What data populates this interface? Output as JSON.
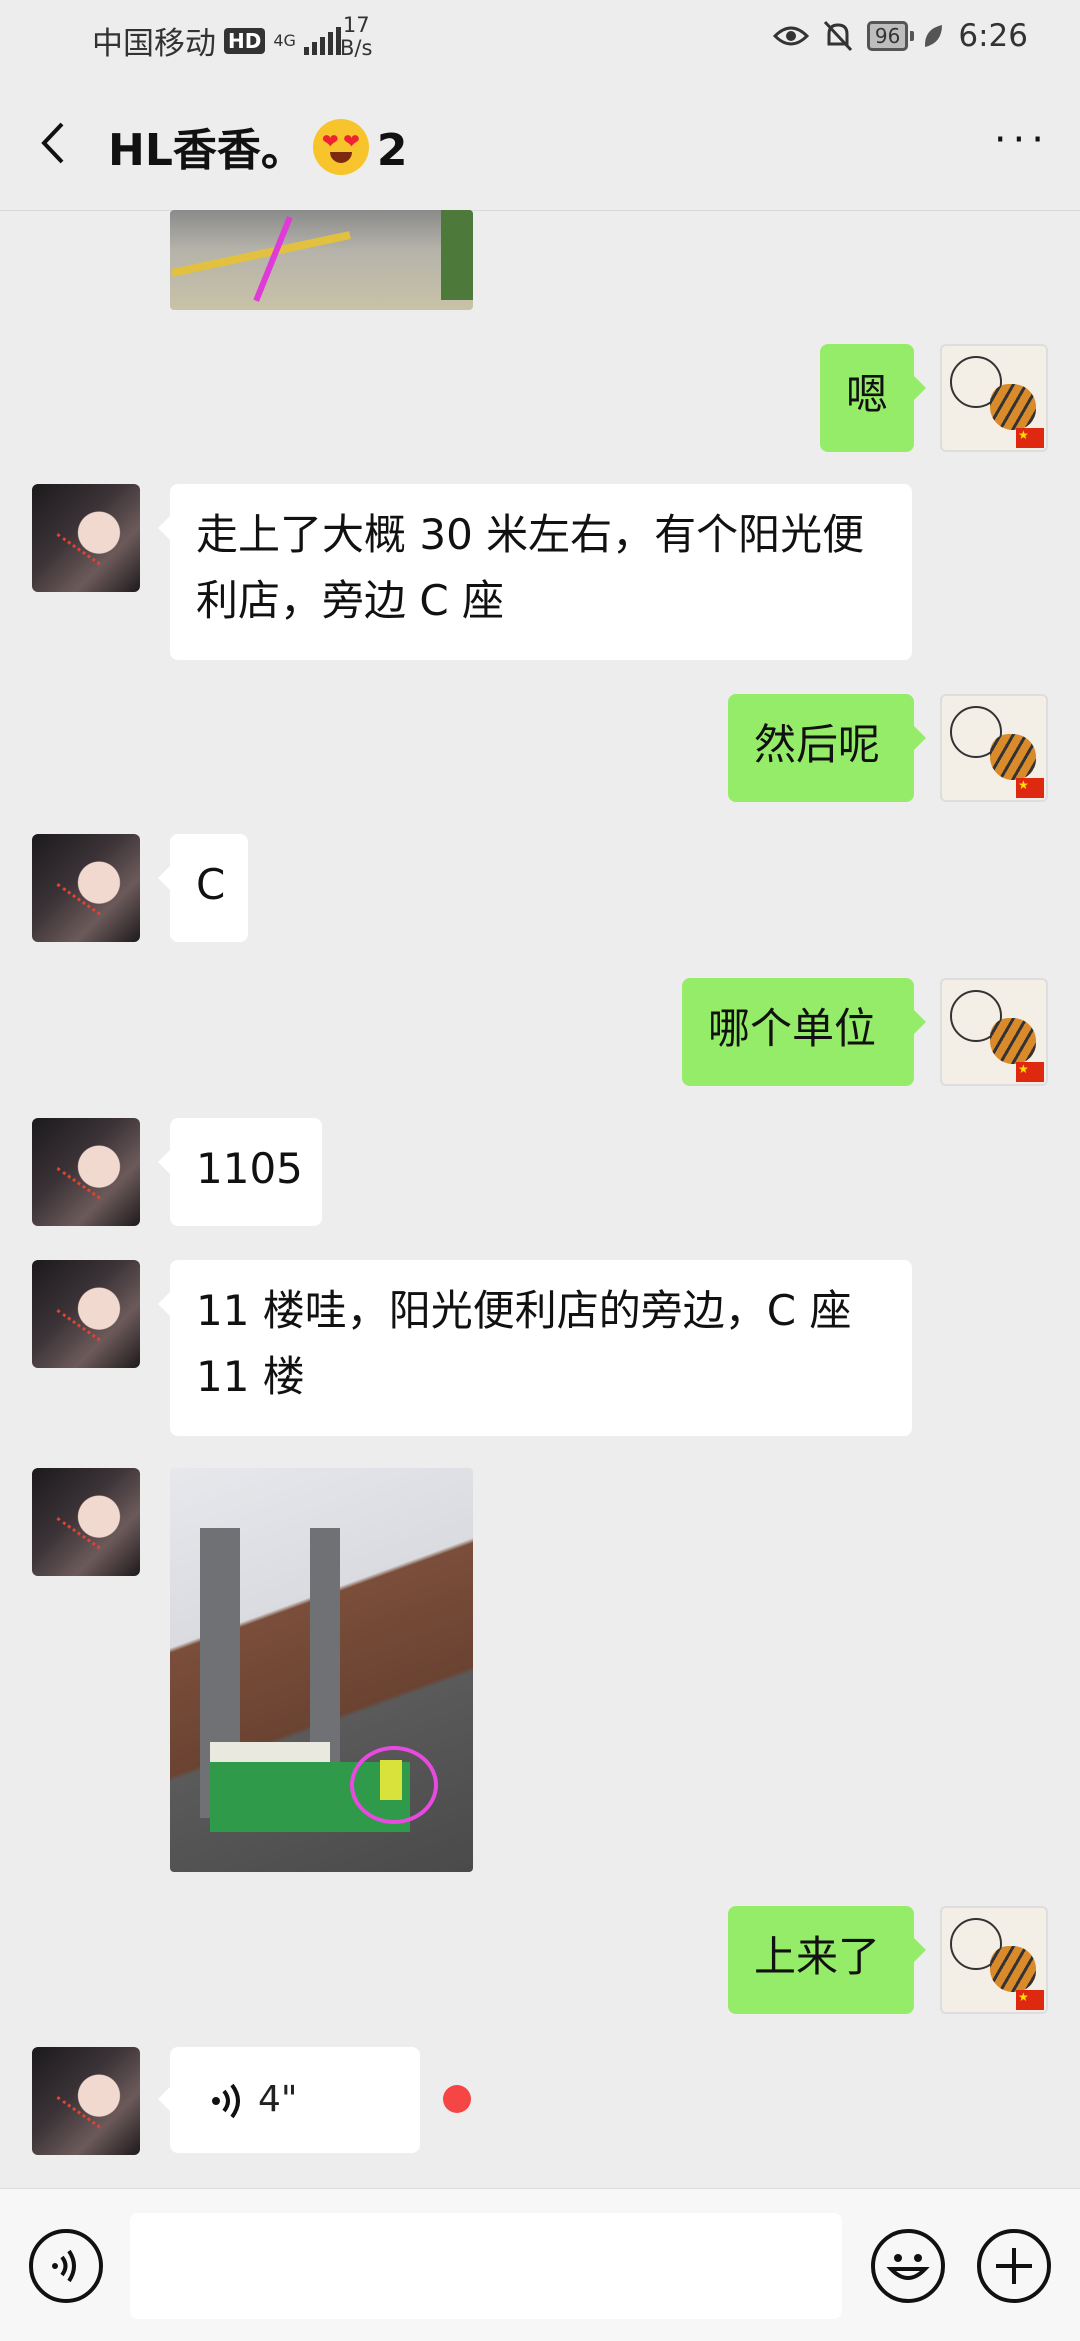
{
  "status_bar": {
    "carrier": "中国移动",
    "hd": "HD",
    "network": "4G",
    "speed_value": "17",
    "speed_unit": "B/s",
    "battery": "96",
    "time": "6:26"
  },
  "header": {
    "title_prefix": "HL香香。",
    "title_suffix": "2",
    "back_icon": "chevron-left-icon",
    "more_icon": "more-dots-icon",
    "more": "···"
  },
  "messages": [
    {
      "side": "left",
      "type": "image",
      "desc": "street photo (cropped)"
    },
    {
      "side": "right",
      "type": "text",
      "text": "嗯"
    },
    {
      "side": "left",
      "type": "text",
      "lines": [
        "走上了大概 30 米左右，有个阳光便",
        "利店，旁边 C 座"
      ]
    },
    {
      "side": "right",
      "type": "text",
      "text": "然后呢"
    },
    {
      "side": "left",
      "type": "text",
      "text": "C"
    },
    {
      "side": "right",
      "type": "text",
      "text": "哪个单位"
    },
    {
      "side": "left",
      "type": "text",
      "text": "1105"
    },
    {
      "side": "left",
      "type": "text",
      "lines": [
        "11 楼哇，阳光便利店的旁边，C 座",
        "11 楼"
      ]
    },
    {
      "side": "left",
      "type": "image",
      "desc": "building photo"
    },
    {
      "side": "right",
      "type": "text",
      "text": "上来了"
    },
    {
      "side": "left",
      "type": "voice",
      "duration": "4\"",
      "unread": true
    }
  ],
  "input_bar": {
    "voice_icon": "voice-mode-icon",
    "emoji_icon": "emoji-icon",
    "plus_icon": "plus-icon"
  },
  "colors": {
    "background": "#ededed",
    "bubble_self": "#95ec69",
    "bubble_other": "#ffffff",
    "unread_dot": "#f54545"
  }
}
